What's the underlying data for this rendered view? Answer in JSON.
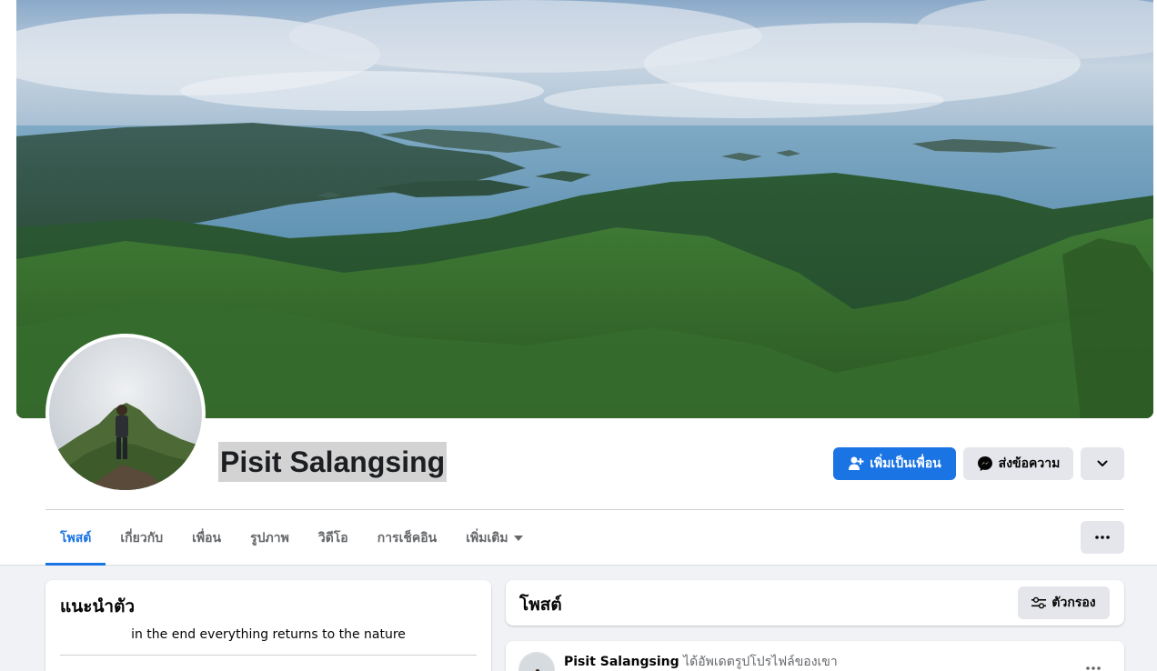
{
  "profile": {
    "name": "Pisit Salangsing"
  },
  "actions": {
    "add_friend_label": "เพิ่มเป็นเพื่อน",
    "message_label": "ส่งข้อความ"
  },
  "tabs": [
    {
      "label": "โพสต์",
      "active": true
    },
    {
      "label": "เกี่ยวกับ"
    },
    {
      "label": "เพื่อน"
    },
    {
      "label": "รูปภาพ"
    },
    {
      "label": "วิดีโอ"
    },
    {
      "label": "การเช็คอิน"
    },
    {
      "label": "เพิ่มเติม"
    }
  ],
  "intro": {
    "title": "แนะนำตัว",
    "bio": "in the end everything returns to the nature"
  },
  "posts": {
    "title": "โพสต์",
    "filter_label": "ตัวกรอง"
  },
  "post": {
    "author": "Pisit Salangsing",
    "action": "ได้อัพเดตรูปโปรไฟล์ของเขา"
  },
  "colors": {
    "accent": "#1b74e4",
    "secondary_button": "#e4e6eb",
    "page_background": "#f0f2f5"
  },
  "icons": {
    "add_friend": "person-add-icon",
    "message": "messenger-icon",
    "dropdown": "chevron-down-icon",
    "more": "ellipsis-icon",
    "filter": "filter-sliders-icon"
  }
}
